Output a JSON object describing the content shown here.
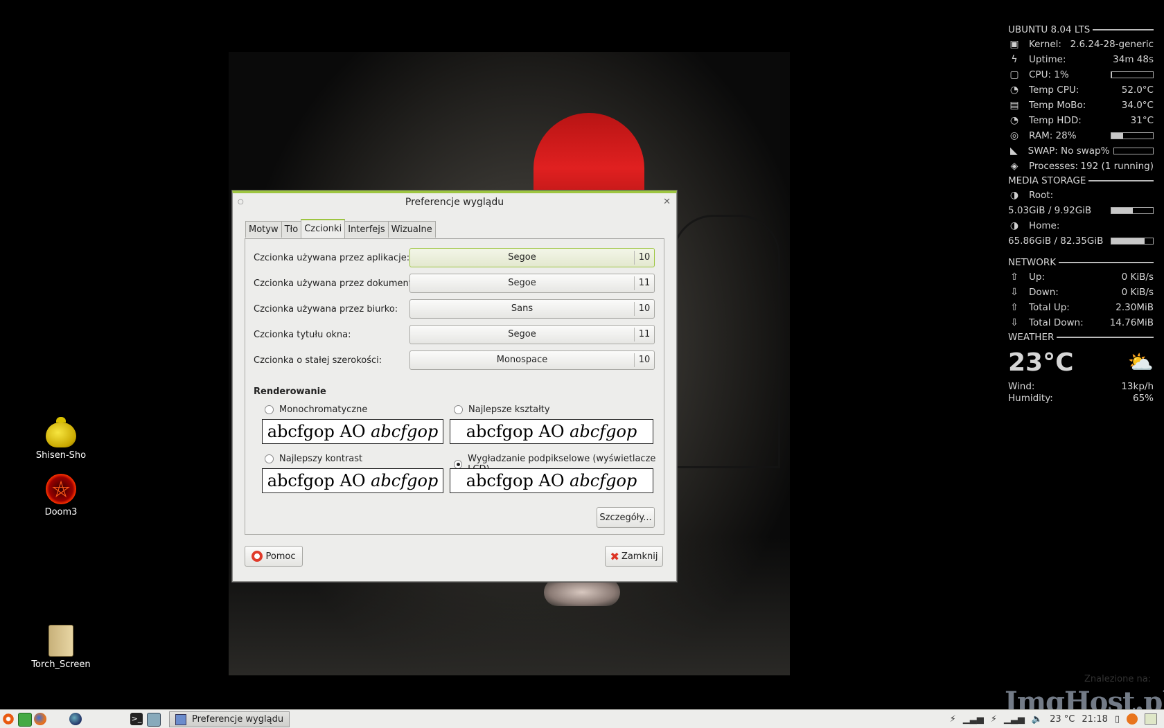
{
  "desktop": {
    "icons": [
      {
        "label": "Shisen-Sho"
      },
      {
        "label": "Doom3"
      },
      {
        "label": "Torch_Screen"
      }
    ]
  },
  "conky": {
    "os_header": "UBUNTU 8.04 LTS",
    "kernel_label": "Kernel:",
    "kernel_value": "2.6.24-28-generic",
    "uptime_label": "Uptime:",
    "uptime_value": "34m 48s",
    "cpu_label": "CPU: 1%",
    "cpu_fraction": 0.01,
    "temp_cpu_label": "Temp CPU:",
    "temp_cpu_value": "52.0°C",
    "temp_mobo_label": "Temp MoBo:",
    "temp_mobo_value": "34.0°C",
    "temp_hdd_label": "Temp HDD:",
    "temp_hdd_value": "31°C",
    "ram_label": "RAM: 28%",
    "ram_fraction": 0.28,
    "swap_label": "SWAP: No swap%",
    "swap_fraction": 0,
    "processes_label": "Processes:",
    "processes_value": "192 (1 running)",
    "storage_header": "MEDIA STORAGE",
    "root_label": "Root:",
    "root_value": "5.03GiB / 9.92GiB",
    "root_fraction": 0.51,
    "home_label": "Home:",
    "home_value": "65.86GiB / 82.35GiB",
    "home_fraction": 0.8,
    "network_header": "NETWORK",
    "up_label": "Up:",
    "up_value": "0 KiB/s",
    "down_label": "Down:",
    "down_value": "0 KiB/s",
    "total_up_label": "Total Up:",
    "total_up_value": "2.30MiB",
    "total_down_label": "Total Down:",
    "total_down_value": "14.76MiB",
    "weather_header": "WEATHER",
    "temperature": "23°C",
    "wind_label": "Wind:",
    "wind_value": "13kp/h",
    "humidity_label": "Humidity:",
    "humidity_value": "65%"
  },
  "dialog": {
    "title": "Preferencje wyglądu",
    "tabs": [
      "Motyw",
      "Tło",
      "Czcionki",
      "Interfejs",
      "Wizualne"
    ],
    "active_tab": "Czcionki",
    "fonts": [
      {
        "label": "Czcionka używana przez aplikacje:",
        "font": "Segoe",
        "size": "10"
      },
      {
        "label": "Czcionka używana przez dokumenty:",
        "font": "Segoe",
        "size": "11"
      },
      {
        "label": "Czcionka używana przez biurko:",
        "font": "Sans",
        "size": "10"
      },
      {
        "label": "Czcionka tytułu okna:",
        "font": "Segoe",
        "size": "11"
      },
      {
        "label": "Czcionka o stałej szerokości:",
        "font": "Monospace",
        "size": "10"
      }
    ],
    "rendering_header": "Renderowanie",
    "rendering_options": [
      {
        "label": "Monochromatyczne",
        "selected": false
      },
      {
        "label": "Najlepsze kształty",
        "selected": false
      },
      {
        "label": "Najlepszy kontrast",
        "selected": false
      },
      {
        "label": "Wygładzanie podpikselowe (wyświetlacze LCD)",
        "selected": true
      }
    ],
    "sample_text_regular": "abcfgop AO ",
    "sample_text_italic": "abcfgop",
    "details_button": "Szczegóły...",
    "help_button": "Pomoc",
    "close_button": "Zamknij"
  },
  "taskbar": {
    "window_button": "Preferencje wyglądu",
    "tray_temp": "23 °C",
    "clock": "21:18"
  },
  "watermark": {
    "small": "Znalezione na:",
    "large": "ImgHost.pl"
  },
  "colors": {
    "accent_green": "#9dc540",
    "dialog_bg": "#ededeb"
  }
}
